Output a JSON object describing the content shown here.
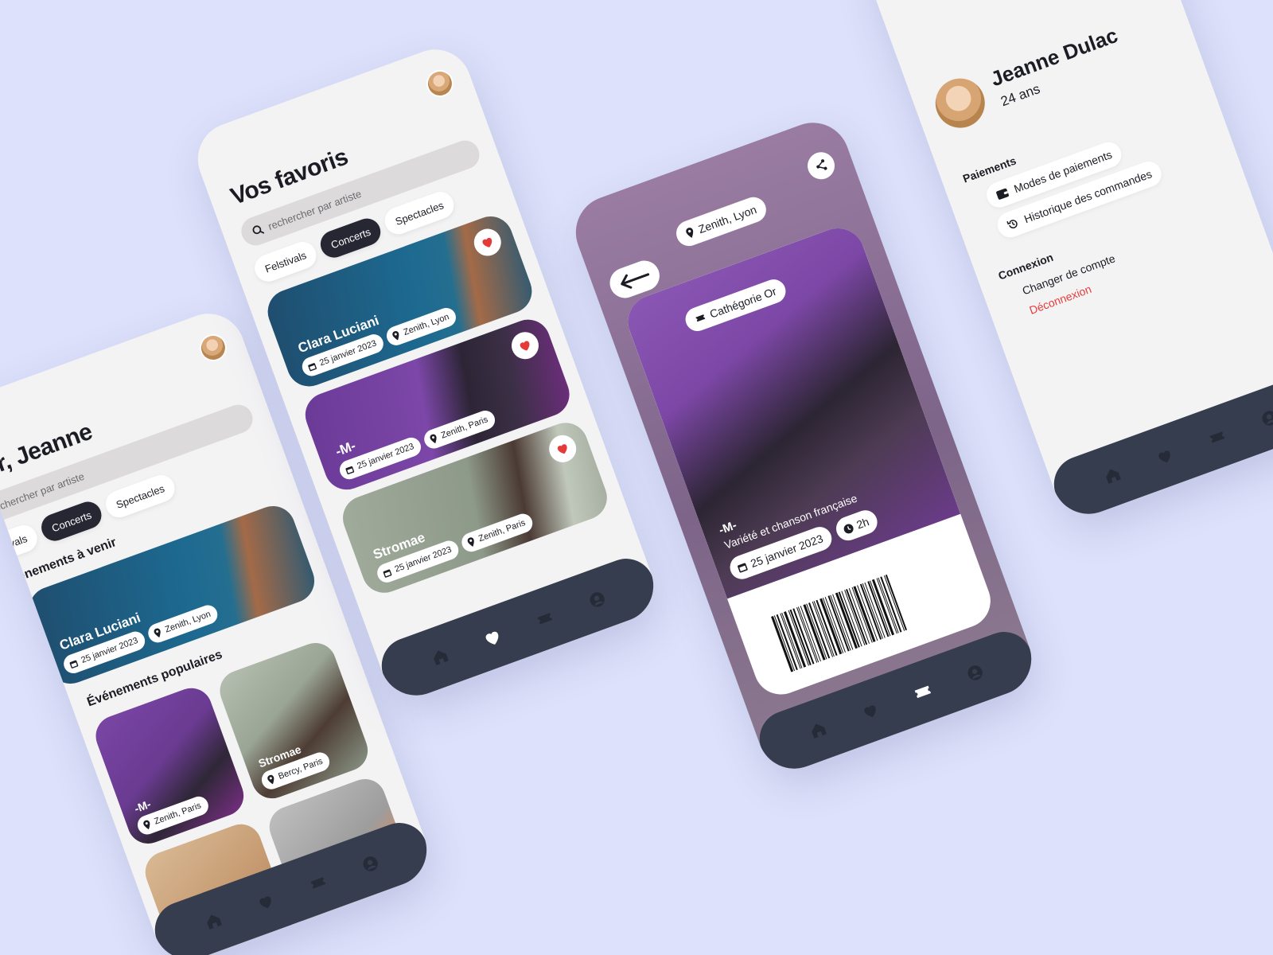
{
  "colors": {
    "background": "#dde1fb",
    "navbar": "#363d4f",
    "accent_heart": "#e53a3a",
    "logout": "#e53a3a"
  },
  "home": {
    "greeting": "our, Jeanne",
    "search_placeholder": "echercher par artiste",
    "chips": [
      "stivals",
      "Concerts",
      "Spectacles"
    ],
    "upcoming_title": "énements à venir",
    "upcoming": {
      "name": "Clara Luciani",
      "date": "25 janvier 2023",
      "venue": "Zenith, Lyon"
    },
    "popular_title": "Événements populaires",
    "popular": [
      {
        "name": "-M-",
        "venue": "Zenith, Paris"
      },
      {
        "name": "Stromae",
        "venue": "Bercy, Paris"
      }
    ]
  },
  "favorites": {
    "title": "Vos favoris",
    "search_placeholder": "rechercher par artiste",
    "chips": [
      "Felstivals",
      "Concerts",
      "Spectacles"
    ],
    "events": [
      {
        "name": "Clara Luciani",
        "date": "25 janvier 2023",
        "venue": "Zenith, Lyon"
      },
      {
        "name": "-M-",
        "date": "25 janvier 2023",
        "venue": "Zenith, Paris"
      },
      {
        "name": "Stromae",
        "date": "25 janvier 2023",
        "venue": "Zenith, Paris"
      }
    ]
  },
  "ticket": {
    "venue": "Zenith, Lyon",
    "category": "Cathégorie Or",
    "artist": "-M-",
    "genre": "Variété et chanson française",
    "date": "25 janvier 2023",
    "duration": "2h"
  },
  "profile": {
    "name": "Jeanne Dulac",
    "age": "24 ans",
    "payments_title": "Paiements",
    "payment_modes": "Modes de paiements",
    "order_history": "Historique des commandes",
    "connection_title": "Connexion",
    "switch_account": "Changer de compte",
    "logout": "Déconnexion"
  },
  "nav_icons": [
    "home-icon",
    "heart-icon",
    "ticket-icon",
    "profile-icon"
  ]
}
